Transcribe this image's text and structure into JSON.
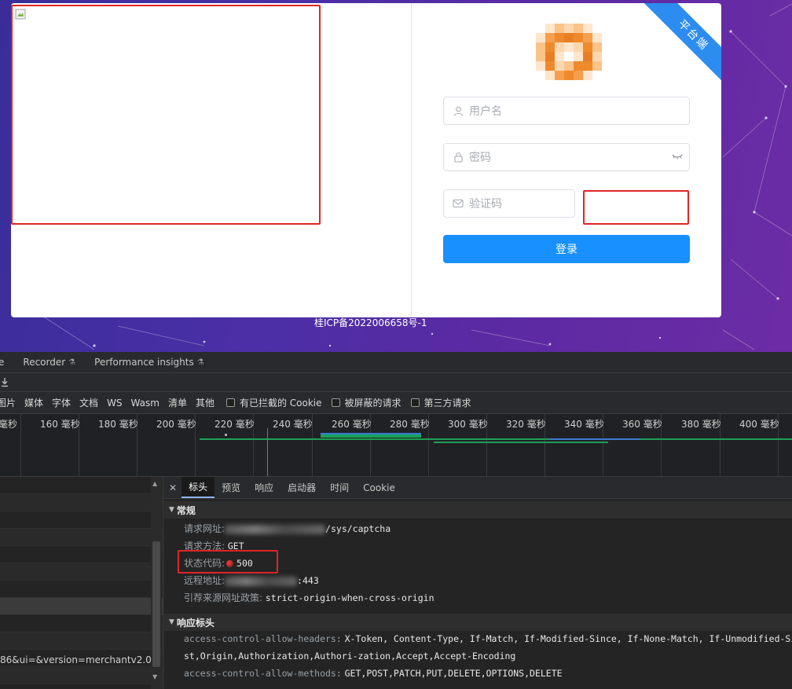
{
  "login": {
    "ribbon_label": "平台端",
    "username_placeholder": "用户名",
    "password_placeholder": "密码",
    "captcha_placeholder": "验证码",
    "login_button": "登录",
    "icp_text": "桂ICP备2022006658号-1",
    "accent_color": "#1890ff",
    "highlight_color": "#e02424"
  },
  "devtools": {
    "top_tabs": [
      {
        "label": "e"
      },
      {
        "label": "Recorder",
        "icon": "flask-icon"
      },
      {
        "label": "Performance insights",
        "icon": "flask-icon"
      }
    ],
    "filter_types": [
      "图片",
      "媒体",
      "字体",
      "文档",
      "WS",
      "Wasm",
      "清单",
      "其他"
    ],
    "checkboxes": [
      "有已拦截的 Cookie",
      "被屏蔽的请求",
      "第三方请求"
    ],
    "timeline_ticks": [
      "毫秒",
      "160 毫秒",
      "180 毫秒",
      "200 毫秒",
      "220 毫秒",
      "240 毫秒",
      "260 毫秒",
      "280 毫秒",
      "300 毫秒",
      "320 毫秒",
      "340 毫秒",
      "360 毫秒",
      "380 毫秒",
      "400 毫秒",
      "毫秒"
    ],
    "request_url_fragment": "86&ui=&version=merchantv2.0",
    "detail_tabs": [
      "标头",
      "预览",
      "响应",
      "启动器",
      "时间",
      "Cookie"
    ],
    "general": {
      "title": "常规",
      "request_url_label": "请求网址:",
      "request_url_value": "/sys/captcha",
      "method_label": "请求方法:",
      "method_value": "GET",
      "status_label": "状态代码:",
      "status_value": "500",
      "remote_label": "远程地址:",
      "remote_value": ":443",
      "referrer_label": "引荐来源网址政策:",
      "referrer_value": "strict-origin-when-cross-origin"
    },
    "response_headers": {
      "title": "响应标头",
      "h1_key": "access-control-allow-headers:",
      "h1_value": "X-Token, Content-Type, If-Match, If-Modified-Since, If-None-Match, If-Unmodified-Since, X-R",
      "h1_value_cont": "st,Origin,Authorization,Authori-zation,Accept,Accept-Encoding",
      "h2_key": "access-control-allow-methods:",
      "h2_value": "GET,POST,PATCH,PUT,DELETE,OPTIONS,DELETE"
    }
  }
}
